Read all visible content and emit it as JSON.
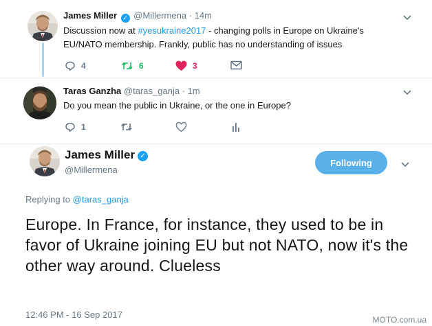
{
  "tweet1": {
    "name": "James Miller",
    "handle": "@Millermena",
    "time": "14m",
    "text_before": "Discussion now at ",
    "hashtag": "#yesukraine2017",
    "text_after": " - changing polls in Europe on Ukraine's EU/NATO membership. Frankly, public has no understanding of issues",
    "replies": "4",
    "retweets": "6",
    "likes": "3",
    "retweet_color": "#17bf63",
    "like_color": "#e0245e"
  },
  "tweet2": {
    "name": "Taras Ganzha",
    "handle": "@taras_ganja",
    "time": "1m",
    "text": "Do you mean the public in Ukraine, or the one in Europe?",
    "replies": "1"
  },
  "main": {
    "name": "James Miller",
    "handle": "@Millermena",
    "follow_label": "Following",
    "follow_color": "#5ab1ea",
    "replying_prefix": "Replying to ",
    "replying_handle": "@taras_ganja",
    "text": "Europe. In France, for instance, they used to be in favor of Ukraine joining EU but not NATO, now it's the other way around. Clueless",
    "timestamp": "12:46 PM - 16 Sep 2017"
  },
  "watermark": "MOTO.com.ua",
  "icons": {
    "verified": "verified-badge-icon",
    "chevron": "chevron-down-icon",
    "reply": "reply-icon",
    "retweet": "retweet-icon",
    "like": "heart-icon",
    "message": "envelope-icon",
    "analytics": "analytics-icon"
  },
  "accent": "#1da1f2"
}
